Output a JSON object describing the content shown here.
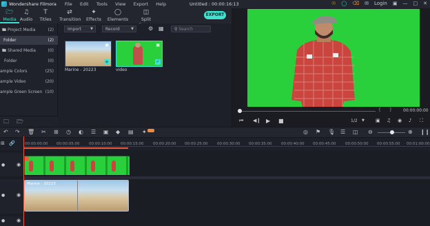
{
  "titlebar": {
    "app_name": "Wondershare Filmora",
    "menu": [
      "File",
      "Edit",
      "Tools",
      "View",
      "Export",
      "Help"
    ],
    "project_title": "Untitled : 00:00:16:13",
    "login": "Login"
  },
  "tabs": [
    {
      "label": "Media",
      "icon": "media-folder-icon",
      "active": true
    },
    {
      "label": "Audio",
      "icon": "music-note-icon",
      "active": false
    },
    {
      "label": "Titles",
      "icon": "text-t-icon",
      "active": false
    },
    {
      "label": "Transition",
      "icon": "transition-icon",
      "active": false
    },
    {
      "label": "Effects",
      "icon": "effects-icon",
      "active": false
    },
    {
      "label": "Elements",
      "icon": "elements-icon",
      "active": false
    },
    {
      "label": "Split Screen",
      "icon": "split-screen-icon",
      "active": false
    }
  ],
  "export_label": "EXPORT",
  "sidebar": {
    "items": [
      {
        "label": "Project Media",
        "count": "(2)"
      },
      {
        "label": "Folder",
        "count": "(2)"
      },
      {
        "label": "Shared Media",
        "count": "(0)"
      },
      {
        "label": "Folder",
        "count": "(0)"
      },
      {
        "label": "ample Colors",
        "count": "(25)"
      },
      {
        "label": "ample Video",
        "count": "(20)"
      },
      {
        "label": "ample Green Screen",
        "count": "(10)"
      }
    ]
  },
  "media": {
    "import_label": "Import",
    "record_label": "Record",
    "search_placeholder": "Search",
    "items": [
      {
        "label": "Marine - 20223"
      },
      {
        "label": "video"
      }
    ]
  },
  "preview": {
    "timecode": "00:00:00:00",
    "page": "1/2"
  },
  "timeline": {
    "ruler": [
      "00:00:00:00",
      "00:00:05:00",
      "00:00:10:00",
      "00:00:15:00",
      "00:00:20:00",
      "00:00:25:00",
      "00:00:30:00",
      "00:00:35:00",
      "00:00:40:00",
      "00:00:45:00",
      "00:00:50:00",
      "00:00:55:00",
      "00:01:00:00"
    ],
    "clip_beach_label": "Marine - 20223"
  },
  "colors": {
    "accent": "#3fe1d0",
    "green_screen": "#29d03b",
    "playhead": "#ef5a3e"
  }
}
